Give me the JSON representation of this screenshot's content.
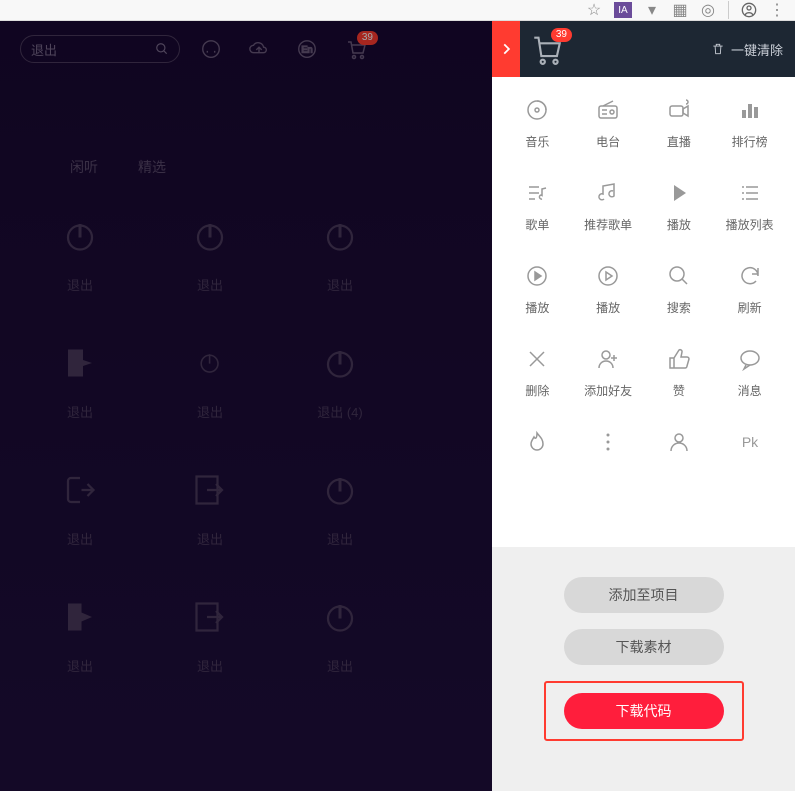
{
  "topbar": {
    "search_placeholder": "退出",
    "cart_badge": "39"
  },
  "tabs": [
    "",
    "闲听",
    "精选"
  ],
  "main_items": [
    {
      "label": "退出",
      "icon": "power"
    },
    {
      "label": "退出",
      "icon": "power"
    },
    {
      "label": "退出",
      "icon": "power"
    },
    {
      "label": "",
      "icon": ""
    },
    {
      "label": "退出",
      "icon": "exit-door"
    },
    {
      "label": "退出",
      "icon": "power-small"
    },
    {
      "label": "退出 (4)",
      "icon": "power"
    },
    {
      "label": "",
      "icon": ""
    },
    {
      "label": "退出",
      "icon": "exit-arrow"
    },
    {
      "label": "退出",
      "icon": "exit-box"
    },
    {
      "label": "退出",
      "icon": "power"
    },
    {
      "label": "",
      "icon": ""
    },
    {
      "label": "退出",
      "icon": "exit-door-solid"
    },
    {
      "label": "退出",
      "icon": "exit-box"
    },
    {
      "label": "退出",
      "icon": "power"
    },
    {
      "label": "",
      "icon": ""
    }
  ],
  "panel": {
    "cart_badge": "39",
    "clear_label": "一键清除",
    "items": [
      {
        "label": "音乐",
        "icon": "music-disc"
      },
      {
        "label": "电台",
        "icon": "radio"
      },
      {
        "label": "直播",
        "icon": "camera"
      },
      {
        "label": "排行榜",
        "icon": "bars"
      },
      {
        "label": "歌单",
        "icon": "list-music"
      },
      {
        "label": "推荐歌单",
        "icon": "music-note"
      },
      {
        "label": "播放",
        "icon": "play"
      },
      {
        "label": "播放列表",
        "icon": "playlist"
      },
      {
        "label": "播放",
        "icon": "play-circle"
      },
      {
        "label": "播放",
        "icon": "play-circle-thin"
      },
      {
        "label": "搜索",
        "icon": "search"
      },
      {
        "label": "刷新",
        "icon": "refresh"
      },
      {
        "label": "删除",
        "icon": "close"
      },
      {
        "label": "添加好友",
        "icon": "add-user"
      },
      {
        "label": "赞",
        "icon": "thumbs-up"
      },
      {
        "label": "消息",
        "icon": "message"
      },
      {
        "label": "",
        "icon": "fire"
      },
      {
        "label": "",
        "icon": "dots-v"
      },
      {
        "label": "",
        "icon": "user"
      },
      {
        "label": "",
        "icon": "pk"
      }
    ],
    "footer": {
      "add_project": "添加至项目",
      "download_asset": "下载素材",
      "download_code": "下载代码"
    }
  }
}
